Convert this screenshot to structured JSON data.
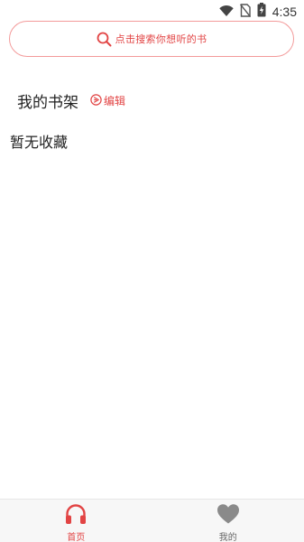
{
  "status_bar": {
    "time": "4:35",
    "icons": [
      "wifi-icon",
      "no-sim-icon",
      "battery-charging-icon"
    ]
  },
  "search": {
    "placeholder": "点击搜索你想听的书",
    "icon": "search-icon"
  },
  "bookshelf": {
    "title": "我的书架",
    "edit_label": "编辑",
    "edit_icon": "edit-icon",
    "empty_text": "暂无收藏"
  },
  "bottom_nav": {
    "items": [
      {
        "label": "首页",
        "icon": "headphones-icon",
        "active": true
      },
      {
        "label": "我的",
        "icon": "heart-icon",
        "active": false
      }
    ]
  },
  "colors": {
    "accent": "#e24444",
    "search_border": "#f39a9a",
    "inactive_icon": "#8a8a8a",
    "nav_background": "#f7f7f7"
  }
}
